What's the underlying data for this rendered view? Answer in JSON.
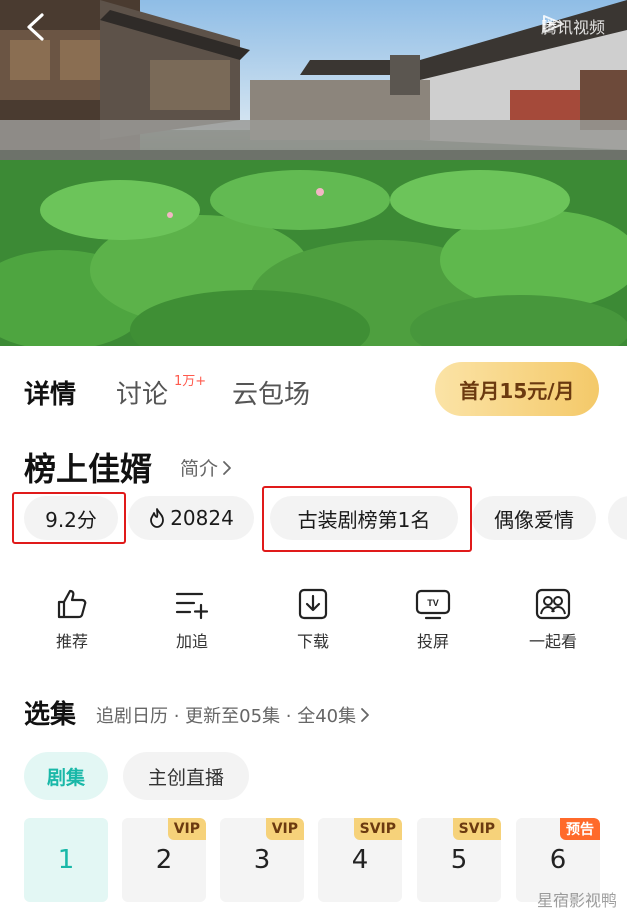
{
  "header": {
    "back_icon": "chevron-left-icon",
    "watermark": "腾讯视频"
  },
  "tabs": {
    "items": [
      {
        "label": "详情",
        "active": true
      },
      {
        "label": "讨论",
        "badge": "1万+"
      },
      {
        "label": "云包场"
      }
    ],
    "promo_button": "首月15元/月"
  },
  "show": {
    "title": "榜上佳婿",
    "intro_link": "简介"
  },
  "tags": [
    {
      "label": "9.2分"
    },
    {
      "label": "20824",
      "icon": "flame-icon"
    },
    {
      "label": "古装剧榜第1名"
    },
    {
      "label": "偶像爱情"
    }
  ],
  "actions": [
    {
      "label": "推荐",
      "icon": "thumbs-up-icon"
    },
    {
      "label": "加追",
      "icon": "add-list-icon"
    },
    {
      "label": "下载",
      "icon": "download-icon"
    },
    {
      "label": "投屏",
      "icon": "tv-cast-icon"
    },
    {
      "label": "一起看",
      "icon": "watch-together-icon"
    }
  ],
  "episodes": {
    "section_title": "选集",
    "meta": "追剧日历 · 更新至05集 · 全40集",
    "chips": [
      "剧集",
      "主创直播"
    ],
    "items": [
      {
        "number": "1",
        "badge": "",
        "current": true
      },
      {
        "number": "2",
        "badge": "VIP"
      },
      {
        "number": "3",
        "badge": "VIP"
      },
      {
        "number": "4",
        "badge": "SVIP"
      },
      {
        "number": "5",
        "badge": "SVIP"
      },
      {
        "number": "6",
        "badge": "预告"
      }
    ]
  },
  "footer": {
    "watermark": "星宿影视鸭"
  },
  "colors": {
    "accent": "#19b8a8",
    "highlight_box": "#e01a1a",
    "vip_badge": "#f6d27a",
    "preview_badge": "#ff6a2b"
  }
}
